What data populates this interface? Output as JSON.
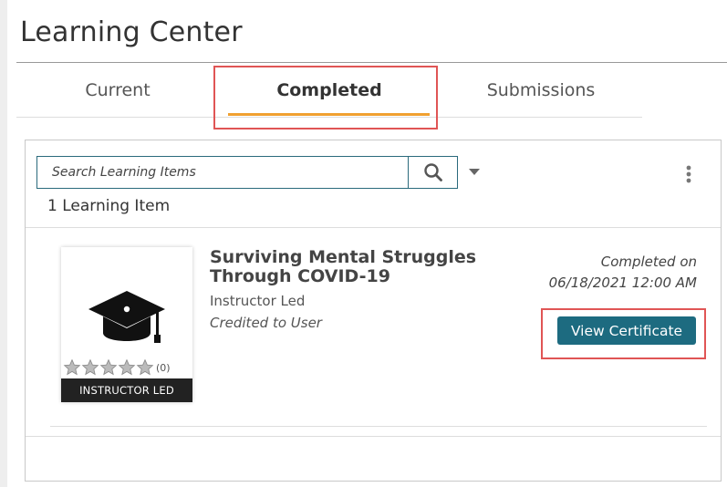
{
  "page": {
    "title": "Learning Center"
  },
  "tabs": [
    {
      "label": "Current",
      "active": false
    },
    {
      "label": "Completed",
      "active": true
    },
    {
      "label": "Submissions",
      "active": false
    }
  ],
  "search": {
    "placeholder": "Search Learning Items",
    "value": ""
  },
  "list": {
    "count_text": "1 Learning Item",
    "items": [
      {
        "title": "Surviving Mental Struggles Through COVID-19",
        "type": "Instructor Led",
        "credit": "Credited to User",
        "thumbnail_label": "INSTRUCTOR LED",
        "thumbnail_icon": "graduation-cap-icon",
        "rating_stars": 0,
        "rating_max": 5,
        "rating_count_text": "(0)",
        "completed_text": "Completed on 06/18/2021 12:00 AM",
        "action_label": "View Certificate"
      }
    ]
  },
  "colors": {
    "accent_tab": "#f0a030",
    "button": "#1d6b80",
    "highlight": "#e05555",
    "search_border": "#2a6a7c"
  }
}
